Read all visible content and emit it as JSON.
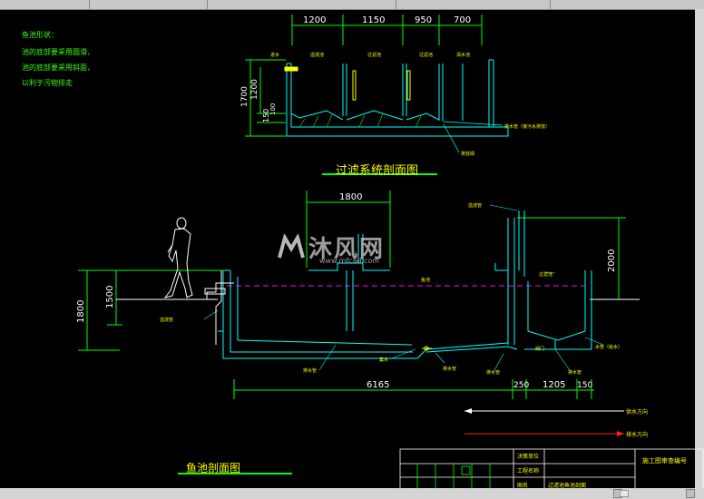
{
  "notes": {
    "heading": "鱼池形状：",
    "line1": "池的底部要采用圆滑，",
    "line2": "池的底部要采用斜面，",
    "line3": "以利于污物排走"
  },
  "filter_section": {
    "title": "过滤系统剖面图",
    "dims_top": [
      "1200",
      "1150",
      "950",
      "700"
    ],
    "dims_left": [
      "1700",
      "1200",
      "150"
    ],
    "dims_left_extra": "100",
    "labels": {
      "pipe_out": "排水管（接污水排放）",
      "pipe_small": "排放阀"
    }
  },
  "pond_section": {
    "title": "鱼池剖面图",
    "dim_top": "1800",
    "dim_right_vertical": "2000",
    "dims_left": [
      "1800",
      "1500"
    ],
    "dims_bottom": [
      "6165",
      "250",
      "1205",
      "150"
    ],
    "labels": {
      "pond": "鱼池",
      "filter_pool": "过滤池",
      "top_right": "溢流管",
      "left_overflow": "溢流管",
      "drain_left": "排水管",
      "drain_mid": "排水管",
      "sump": "集水",
      "drain_bottom": "排水管",
      "drain_right": "排水管",
      "water_pipe": "水管（给水）",
      "valve": "阀门"
    }
  },
  "legend": {
    "white_line": "供水方向",
    "red_line": "排水方向"
  },
  "title_block": {
    "project": "施工图审查编号",
    "rows": [
      "决策单位",
      "工程名称",
      "图名"
    ],
    "drawing_name": "过滤池鱼池剖面"
  },
  "watermark": {
    "text": "沐风网",
    "url": "www.mfcad.com"
  },
  "colors": {
    "background": "#000000",
    "structure": "#00ffff",
    "dimension": "#00ff00",
    "text": "#ffff00",
    "water": "#ff00ff"
  }
}
